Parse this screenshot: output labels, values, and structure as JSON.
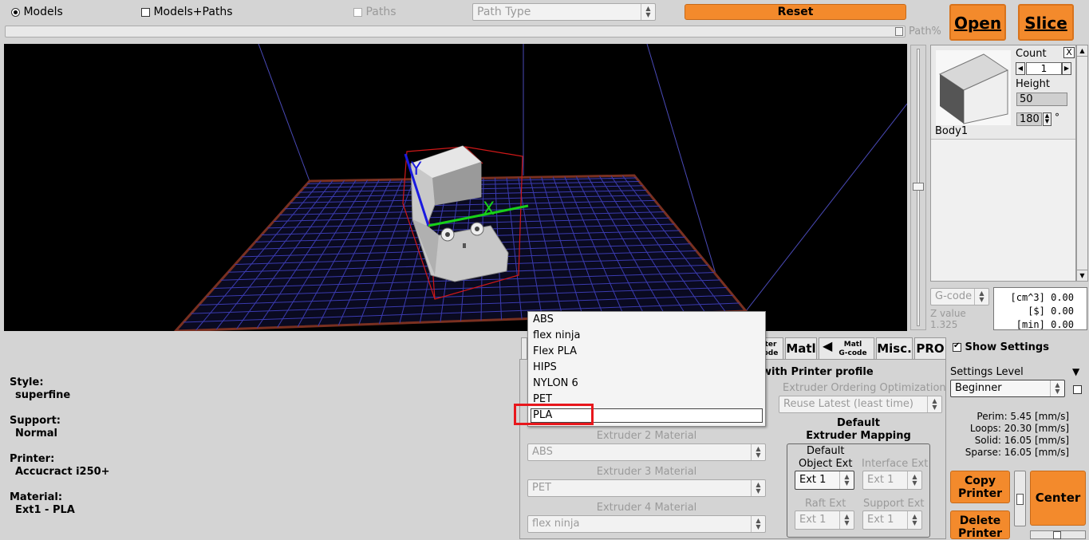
{
  "topbar": {
    "models_label": "Models",
    "models_paths_label": "Models+Paths",
    "paths_label": "Paths",
    "path_type_placeholder": "Path Type",
    "reset_label": "Reset",
    "path_percent_label": "Path%",
    "open_label": "Open",
    "slice_label": "Slice"
  },
  "viewport": {
    "axis_x": "X",
    "axis_y": "Y"
  },
  "model_panel": {
    "count_label": "Count",
    "count_value": "1",
    "close_label": "X",
    "height_label": "Height",
    "height_value": "50",
    "rotation_value": "180",
    "degree_symbol": "°",
    "model_name": "Body1"
  },
  "stats": {
    "gcode_label": "G-code",
    "zvalue_label": "Z value",
    "zvalue": "1.325",
    "rows": [
      "[cm^3] 0.00",
      "[$] 0.00",
      "[min] 0.00"
    ]
  },
  "summary": {
    "style_label": "Style:",
    "style_value": "superfine",
    "support_label": "Support:",
    "support_value": "Normal",
    "printer_label": "Printer:",
    "printer_value": "Accucract i250+",
    "material_label": "Material:",
    "material_value": "Ext1 - PLA"
  },
  "material_dropdown": {
    "options": [
      "ABS",
      "flex ninja",
      "Flex PLA",
      "HIPS",
      "NYLON 6",
      "PET",
      "PLA"
    ],
    "highlighted": "PLA"
  },
  "extruders": {
    "ext2_label": "Extruder 2 Material",
    "ext2_value": "ABS",
    "ext3_label": "Extruder 3 Material",
    "ext3_value": "PET",
    "ext4_label": "Extruder 4 Material",
    "ext4_value": "flex ninja"
  },
  "tabs": {
    "printer_gcode_a": "ter",
    "printer_gcode_b": "ode",
    "matl": "Matl",
    "matl_gcode_a": "Matl",
    "matl_gcode_b": "G-code",
    "misc": "Misc.",
    "pro": "PRO"
  },
  "profile": {
    "title": "with Printer profile",
    "ordering_label": "Extruder Ordering Optimization",
    "ordering_value": "Reuse Latest (least time)",
    "mapping_title_1": "Default",
    "mapping_title_2": "Extruder Mapping",
    "default_label": "Default",
    "object_ext_label": "Object Ext",
    "object_ext_value": "Ext 1",
    "interface_ext_label": "Interface Ext",
    "interface_ext_value": "Ext 1",
    "raft_ext_label": "Raft Ext",
    "raft_ext_value": "Ext 1",
    "support_ext_label": "Support Ext",
    "support_ext_value": "Ext 1"
  },
  "settings": {
    "show_settings_label": "Show Settings",
    "level_label": "Settings Level",
    "level_value": "Beginner",
    "speeds": [
      "Perim:  5.45 [mm/s]",
      "Loops:  20.30 [mm/s]",
      "Solid:  16.05 [mm/s]",
      "Sparse:  16.05 [mm/s]"
    ],
    "copy_printer_1": "Copy",
    "copy_printer_2": "Printer",
    "delete_printer_1": "Delete",
    "delete_printer_2": "Printer",
    "center_label": "Center"
  },
  "colors": {
    "accent": "#f38a2c",
    "highlight_box": "#e8171c"
  }
}
